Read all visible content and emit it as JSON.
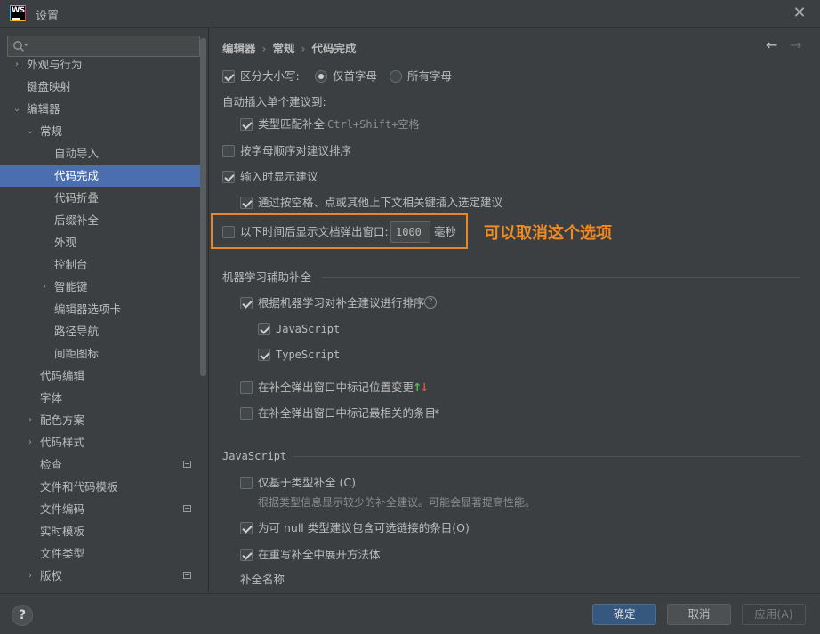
{
  "window": {
    "title": "设置",
    "colors": {
      "selection": "#4b6eaf",
      "annotation": "#f08a22",
      "primary_button": "#365880"
    }
  },
  "search": {
    "placeholder": ""
  },
  "tree": [
    {
      "label": "外观与行为",
      "expand": "›"
    },
    {
      "label": "键盘映射",
      "expand": ""
    },
    {
      "label": "编辑器",
      "expand": "⌄"
    },
    {
      "label": "常规",
      "expand": "⌄"
    },
    {
      "label": "自动导入",
      "expand": ""
    },
    {
      "label": "代码完成",
      "expand": ""
    },
    {
      "label": "代码折叠",
      "expand": ""
    },
    {
      "label": "后缀补全",
      "expand": ""
    },
    {
      "label": "外观",
      "expand": ""
    },
    {
      "label": "控制台",
      "expand": ""
    },
    {
      "label": "智能键",
      "expand": "›"
    },
    {
      "label": "编辑器选项卡",
      "expand": ""
    },
    {
      "label": "路径导航",
      "expand": ""
    },
    {
      "label": "间距图标",
      "expand": ""
    },
    {
      "label": "代码编辑",
      "expand": ""
    },
    {
      "label": "字体",
      "expand": ""
    },
    {
      "label": "配色方案",
      "expand": "›"
    },
    {
      "label": "代码样式",
      "expand": "›"
    },
    {
      "label": "检查",
      "expand": ""
    },
    {
      "label": "文件和代码模板",
      "expand": ""
    },
    {
      "label": "文件编码",
      "expand": ""
    },
    {
      "label": "实时模板",
      "expand": ""
    },
    {
      "label": "文件类型",
      "expand": ""
    },
    {
      "label": "版权",
      "expand": "›"
    }
  ],
  "breadcrumb": {
    "p1": "编辑器",
    "sep": "›",
    "p2": "常规",
    "p3": "代码完成"
  },
  "nav": {
    "back": "←",
    "forward": "→"
  },
  "options": {
    "case_sensitive": "区分大小写:",
    "radio_first": "仅首字母",
    "radio_all": "所有字母",
    "auto_insert_heading": "自动插入单个建议到:",
    "type_match": "类型匹配补全",
    "type_match_shortcut": "Ctrl+Shift+空格",
    "sort_alpha": "按字母顺序对建议排序",
    "show_on_type": "输入时显示建议",
    "insert_on_space": "通过按空格、点或其他上下文相关键插入选定建议",
    "show_doc_popup": "以下时间后显示文档弹出窗口:",
    "doc_popup_value": "1000",
    "doc_popup_unit": "毫秒"
  },
  "annotation": "可以取消这个选项",
  "ml_section": {
    "title": "机器学习辅助补全",
    "sort_ml": "根据机器学习对补全建议进行排序",
    "help": "?",
    "javascript": "JavaScript",
    "typescript": "TypeScript",
    "mark_position": "在补全弹出窗口中标记位置变更",
    "arrow_up": "↑",
    "arrow_down": "↓",
    "mark_relevant": "在补全弹出窗口中标记最相关的条目",
    "star": "*"
  },
  "js_section": {
    "title": "JavaScript",
    "type_based": "仅基于类型补全 (C)",
    "type_based_hint": "根据类型信息显示较少的补全建议。可能会显著提高性能。",
    "nullable": "为可 null 类型建议包含可选链接的条目(O)",
    "expand_method": "在重写补全中展开方法体",
    "completion_name": "补全名称"
  },
  "buttons": {
    "help": "?",
    "ok": "确定",
    "cancel": "取消",
    "apply": "应用(A)"
  }
}
